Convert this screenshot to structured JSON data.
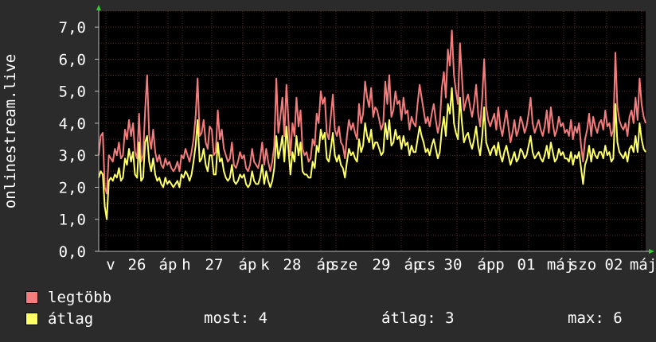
{
  "chart_data": {
    "type": "line",
    "ylabel": "onlinestream.live",
    "ylim": [
      0,
      7.5
    ],
    "yticks": [
      "0,0",
      "1,0",
      "2,0",
      "3,0",
      "4,0",
      "5,0",
      "6,0",
      "7,0"
    ],
    "xticks": [
      "v",
      "26",
      "áp",
      "h",
      "27",
      "áp",
      "k",
      "28",
      "áp",
      "sze",
      "29",
      "áp",
      "cs",
      "30",
      "áp",
      "p",
      "01",
      "máj",
      "szo",
      "02",
      "máj"
    ],
    "grid": true,
    "series": [
      {
        "name": "legtöbb",
        "color": "#f47c7c",
        "values": [
          3.0,
          3.6,
          3.7,
          2.0,
          1.8,
          3.0,
          2.9,
          2.8,
          3.2,
          3.0,
          3.4,
          2.9,
          3.0,
          3.8,
          3.5,
          4.1,
          3.6,
          4.0,
          3.1,
          2.9,
          4.3,
          2.8,
          3.0,
          4.4,
          5.5,
          3.6,
          3.2,
          3.8,
          3.1,
          2.8,
          3.0,
          2.7,
          2.6,
          2.9,
          2.7,
          2.8,
          2.6,
          2.5,
          2.6,
          2.8,
          2.5,
          3.0,
          2.9,
          3.2,
          3.0,
          2.8,
          3.1,
          3.5,
          4.2,
          5.4,
          3.6,
          3.7,
          4.1,
          3.4,
          3.2,
          3.9,
          3.8,
          3.0,
          3.1,
          4.4,
          3.5,
          3.8,
          3.2,
          3.0,
          2.8,
          2.9,
          3.4,
          2.7,
          2.6,
          2.8,
          3.1,
          2.9,
          3.0,
          2.6,
          2.5,
          2.7,
          3.2,
          2.8,
          2.7,
          2.6,
          2.9,
          3.4,
          2.7,
          3.2,
          2.8,
          2.5,
          2.8,
          3.3,
          5.4,
          3.7,
          4.2,
          4.8,
          3.6,
          5.2,
          4.1,
          3.0,
          4.0,
          3.6,
          4.8,
          3.9,
          4.4,
          3.2,
          3.0,
          3.1,
          2.8,
          2.9,
          3.5,
          3.3,
          4.3,
          4.0,
          5.0,
          4.6,
          4.8,
          3.7,
          3.5,
          4.2,
          4.9,
          3.8,
          3.6,
          3.9,
          3.4,
          3.3,
          2.9,
          3.6,
          4.1,
          3.8,
          4.0,
          3.7,
          3.5,
          4.6,
          4.0,
          4.3,
          5.3,
          4.8,
          4.5,
          5.1,
          4.2,
          4.5,
          4.4,
          4.1,
          3.8,
          4.0,
          5.3,
          4.6,
          5.5,
          4.2,
          4.4,
          5.0,
          4.6,
          4.7,
          4.1,
          4.8,
          4.3,
          4.4,
          3.8,
          4.2,
          4.0,
          3.9,
          4.6,
          5.2,
          4.8,
          4.4,
          4.0,
          4.2,
          3.9,
          4.3,
          4.6,
          4.1,
          3.7,
          4.0,
          5.1,
          5.6,
          4.8,
          6.3,
          5.8,
          6.9,
          5.5,
          5.0,
          4.6,
          6.5,
          5.4,
          4.4,
          4.7,
          4.9,
          4.5,
          4.2,
          4.6,
          5.2,
          4.3,
          3.9,
          4.8,
          6.0,
          4.5,
          4.1,
          3.9,
          4.1,
          4.3,
          3.8,
          4.5,
          3.9,
          3.6,
          4.0,
          4.4,
          3.9,
          3.4,
          3.7,
          4.1,
          3.6,
          3.8,
          4.2,
          4.0,
          3.7,
          3.9,
          4.3,
          4.8,
          4.0,
          3.7,
          3.9,
          4.1,
          3.8,
          3.6,
          3.9,
          4.4,
          3.7,
          4.5,
          4.0,
          3.6,
          3.8,
          4.2,
          3.9,
          4.0,
          3.7,
          3.8,
          3.6,
          4.1,
          3.5,
          3.9,
          3.7,
          4.0,
          3.3,
          2.8,
          3.5,
          3.8,
          4.3,
          3.6,
          4.2,
          3.9,
          3.7,
          4.0,
          4.1,
          3.8,
          4.4,
          3.9,
          4.0,
          3.6,
          3.8,
          6.2,
          4.5,
          4.1,
          3.9,
          3.8,
          4.0,
          3.6,
          4.2,
          4.4,
          4.0,
          4.8,
          4.1,
          5.4,
          4.6,
          4.2,
          4.0
        ]
      },
      {
        "name": "átlag",
        "color": "#ffff66",
        "values": [
          2.3,
          2.5,
          2.4,
          1.4,
          1.0,
          2.2,
          2.3,
          2.2,
          2.4,
          2.3,
          2.6,
          2.2,
          2.3,
          2.9,
          2.7,
          3.2,
          2.8,
          3.1,
          2.4,
          2.3,
          3.4,
          2.2,
          2.3,
          3.4,
          3.6,
          2.8,
          2.5,
          2.9,
          2.4,
          2.2,
          2.3,
          2.1,
          2.0,
          2.3,
          2.1,
          2.2,
          2.1,
          2.0,
          2.1,
          2.2,
          2.0,
          2.4,
          2.3,
          2.5,
          2.4,
          2.2,
          2.4,
          2.8,
          3.3,
          4.1,
          2.8,
          2.9,
          3.2,
          2.7,
          2.5,
          3.0,
          3.0,
          2.4,
          2.4,
          3.4,
          2.8,
          2.9,
          2.5,
          2.3,
          2.2,
          2.3,
          2.7,
          2.2,
          2.1,
          2.2,
          2.4,
          2.3,
          2.4,
          2.1,
          2.0,
          2.1,
          2.5,
          2.2,
          2.1,
          2.1,
          2.3,
          2.7,
          2.1,
          2.5,
          2.2,
          2.0,
          2.2,
          2.6,
          3.6,
          2.9,
          3.2,
          3.6,
          2.8,
          3.9,
          3.2,
          2.4,
          3.1,
          2.8,
          3.6,
          3.0,
          3.4,
          2.5,
          2.4,
          2.4,
          2.3,
          2.3,
          2.8,
          2.6,
          3.3,
          3.1,
          3.8,
          3.5,
          3.7,
          2.9,
          2.8,
          3.2,
          3.7,
          3.0,
          2.8,
          3.0,
          2.7,
          2.6,
          2.3,
          2.8,
          3.2,
          3.0,
          3.1,
          2.9,
          2.8,
          3.5,
          3.1,
          3.3,
          4.0,
          3.6,
          3.4,
          3.8,
          3.2,
          3.4,
          3.4,
          3.2,
          3.0,
          3.1,
          4.0,
          3.5,
          4.1,
          3.3,
          3.4,
          3.8,
          3.5,
          3.6,
          3.2,
          3.6,
          3.3,
          3.4,
          3.0,
          3.3,
          3.1,
          3.1,
          3.5,
          3.9,
          3.6,
          3.4,
          3.1,
          3.2,
          3.0,
          3.3,
          3.5,
          3.2,
          2.9,
          3.1,
          3.8,
          4.2,
          3.6,
          4.6,
          4.3,
          5.1,
          4.0,
          3.7,
          3.5,
          4.8,
          4.0,
          3.4,
          3.6,
          3.7,
          3.4,
          3.2,
          3.5,
          3.9,
          3.3,
          3.0,
          3.6,
          4.5,
          3.4,
          3.2,
          3.0,
          3.2,
          3.3,
          3.0,
          3.4,
          3.0,
          2.8,
          3.1,
          3.3,
          3.0,
          2.7,
          2.9,
          3.1,
          2.8,
          2.9,
          3.2,
          3.1,
          2.9,
          3.0,
          3.3,
          3.6,
          3.1,
          2.9,
          3.0,
          3.1,
          2.9,
          2.8,
          3.0,
          3.3,
          2.9,
          3.4,
          3.1,
          2.8,
          2.9,
          3.2,
          3.0,
          3.1,
          2.9,
          2.9,
          2.8,
          3.1,
          2.7,
          3.0,
          2.9,
          3.1,
          2.6,
          2.1,
          2.7,
          2.9,
          3.3,
          2.8,
          3.2,
          3.0,
          2.9,
          3.1,
          3.1,
          2.9,
          3.3,
          3.0,
          3.1,
          2.8,
          2.9,
          4.6,
          3.4,
          3.1,
          3.0,
          2.9,
          3.1,
          2.8,
          3.2,
          3.3,
          3.1,
          3.6,
          3.1,
          4.0,
          3.5,
          3.2,
          3.1
        ]
      }
    ]
  },
  "legend": {
    "items": [
      {
        "label": "legtöbb",
        "color": "#f47c7c"
      },
      {
        "label": "átlag",
        "color": "#ffff66"
      }
    ]
  },
  "stats": {
    "most": "most: 4",
    "atlag": "átlag: 3",
    "max": "max: 6"
  }
}
